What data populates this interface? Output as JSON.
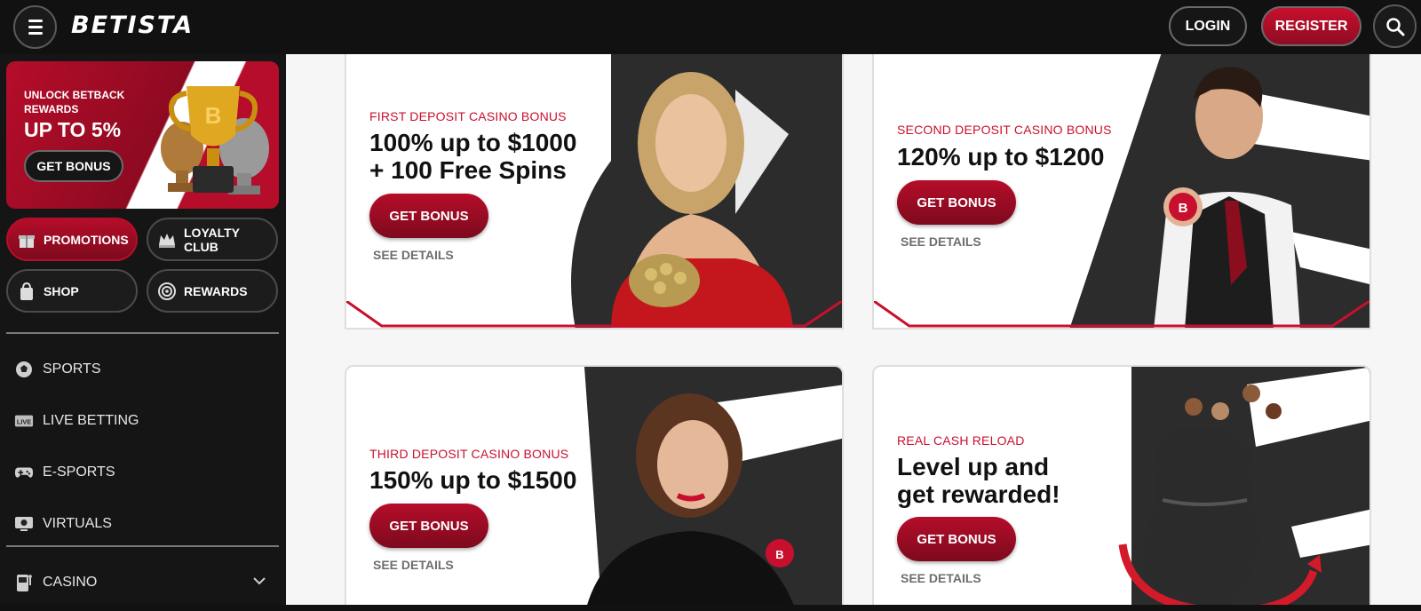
{
  "header": {
    "logo": "BETISTA",
    "login_label": "LOGIN",
    "register_label": "REGISTER",
    "menu_icon": "hamburger-icon",
    "search_icon": "search-icon"
  },
  "sidebar": {
    "promo": {
      "line1": "UNLOCK BETBACK REWARDS",
      "line2": "UP TO 5%",
      "button": "GET BONUS"
    },
    "pills": [
      {
        "label": "PROMOTIONS",
        "icon": "gift-icon",
        "active": true
      },
      {
        "label": "LOYALTY CLUB",
        "icon": "crown-icon",
        "active": false
      },
      {
        "label": "SHOP",
        "icon": "shopping-bag-icon",
        "active": false
      },
      {
        "label": "REWARDS",
        "icon": "target-icon",
        "active": false
      }
    ],
    "nav": [
      {
        "label": "SPORTS",
        "icon": "soccer-ball-icon"
      },
      {
        "label": "LIVE BETTING",
        "icon": "live-icon"
      },
      {
        "label": "E-SPORTS",
        "icon": "gamepad-icon"
      },
      {
        "label": "VIRTUALS",
        "icon": "virtual-monitor-icon"
      },
      {
        "label": "CASINO",
        "icon": "slot-machine-icon"
      }
    ]
  },
  "cards": [
    {
      "eyebrow": "FIRST DEPOSIT CASINO BONUS",
      "headline_1": "100% up to $1000",
      "headline_2": "+ 100 Free Spins",
      "button": "GET BONUS",
      "details": "SEE DETAILS"
    },
    {
      "eyebrow": "SECOND DEPOSIT CASINO BONUS",
      "headline_1": "120% up to $1200",
      "headline_2": "",
      "button": "GET BONUS",
      "details": "SEE DETAILS"
    },
    {
      "eyebrow": "THIRD DEPOSIT CASINO BONUS",
      "headline_1": "150% up to $1500",
      "headline_2": "",
      "button": "GET BONUS",
      "details": "SEE DETAILS"
    },
    {
      "eyebrow": "REAL CASH RELOAD",
      "headline_1": "Level up and",
      "headline_2": "get rewarded!",
      "button": "GET BONUS",
      "details": "SEE DETAILS"
    }
  ],
  "colors": {
    "brand_red": "#c8102e",
    "dark": "#111111",
    "panel": "#151515"
  }
}
